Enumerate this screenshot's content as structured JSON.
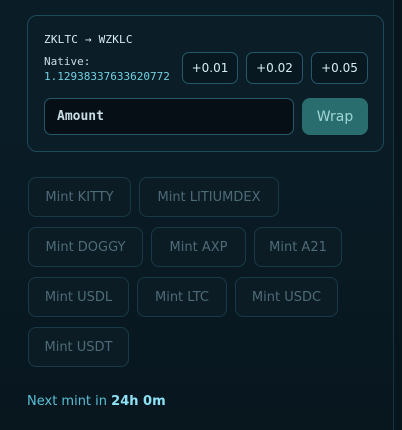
{
  "wrap": {
    "pair_label": "ZKLTC → WZKLC",
    "native_label": "Native:",
    "native_value": "1.12938337633620772",
    "increments": [
      "+0.01",
      "+0.02",
      "+0.05"
    ],
    "amount_placeholder": "Amount",
    "wrap_button": "Wrap"
  },
  "mint_buttons": [
    "Mint KITTY",
    "Mint LITIUMDEX",
    "Mint DOGGY",
    "Mint AXP",
    "Mint A21",
    "Mint USDL",
    "Mint LTC",
    "Mint USDC",
    "Mint USDT"
  ],
  "next_mint": {
    "prefix": "Next mint in",
    "time": "24h 0m"
  },
  "colors": {
    "accent": "#58bfd5",
    "wrap_button_bg": "#2a6d6e"
  }
}
